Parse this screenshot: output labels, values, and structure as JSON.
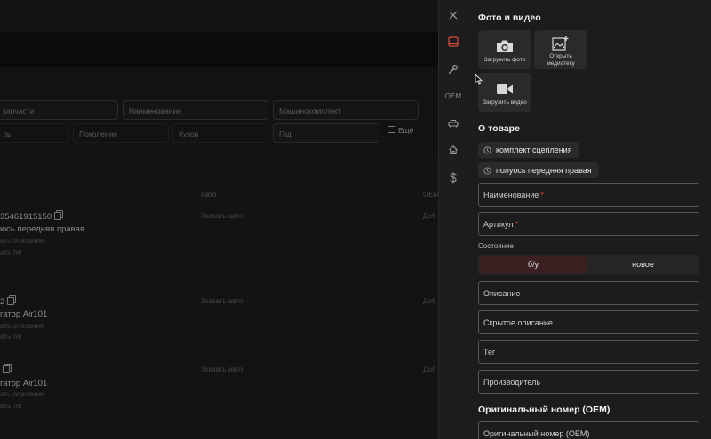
{
  "background": {
    "filters": {
      "spare_part_placeholder": "запчасти",
      "name_placeholder": "Наименование",
      "machine_kit_placeholder": "Машинокомплект",
      "row2_col1": "ль",
      "generation": "Поколение",
      "body": "Кузов",
      "year": "Год",
      "more": "Ещё"
    },
    "columns": {
      "auto": "Авто",
      "oem": "OEM"
    },
    "items": [
      {
        "title_line1": "35461915150",
        "title_line2": "юсь передняя правая",
        "desc": "ать описание",
        "tag": "ать тег",
        "auto_link": "Указать авто",
        "oem_link": "Доб"
      },
      {
        "title_line1": "2",
        "title_line2": "гатор Air101",
        "desc": "ать описание",
        "tag": "ать тег",
        "auto_link": "Указать авто",
        "oem_link": "Доб"
      },
      {
        "title_line1": "",
        "title_line2": "гатор Air101",
        "desc": "ать описание",
        "tag": "ать тег",
        "auto_link": "Указать авто",
        "oem_link": "Доб"
      }
    ]
  },
  "rail": {
    "oem_label": "OEM",
    "accent_color": "#e04a3f"
  },
  "panel": {
    "media": {
      "heading": "Фото и видео",
      "upload_photo": "Загрузить фото",
      "open_library_line1": "Открыть",
      "open_library_line2": "медиатеку",
      "upload_video": "Загрузить видео"
    },
    "product": {
      "heading": "О товаре",
      "suggestions": [
        "комплект сцепления",
        "полуось передняя правая"
      ],
      "name_placeholder": "Наименование",
      "article_placeholder": "Артикул",
      "required_mark": "*",
      "condition_label": "Состояние",
      "condition_options": [
        "б/у",
        "новое"
      ],
      "condition_selected": "б/у",
      "description_placeholder": "Описание",
      "hidden_description_placeholder": "Скрытое описание",
      "tag_placeholder": "Тег",
      "manufacturer_placeholder": "Производитель"
    },
    "oem": {
      "heading": "Оригинальный номер (OEM)",
      "input_placeholder": "Оригинальный номер (OEM)"
    }
  }
}
